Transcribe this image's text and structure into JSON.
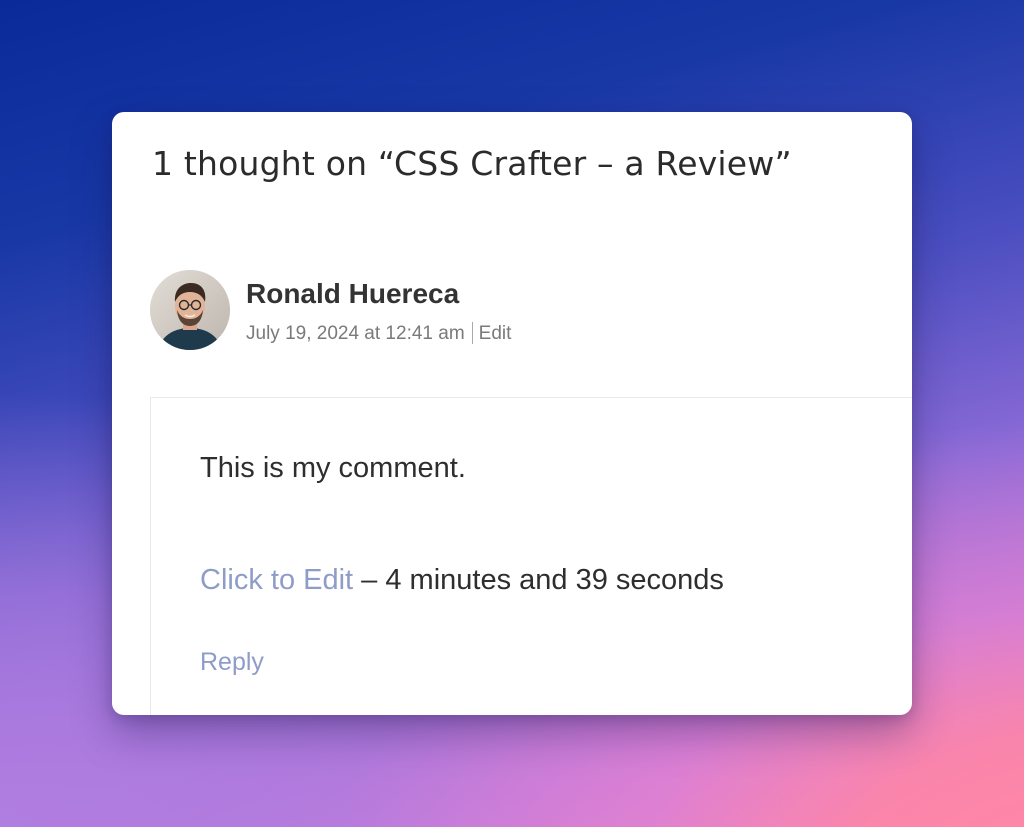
{
  "comments": {
    "title": "1 thought on “CSS Crafter – a Review”"
  },
  "comment": {
    "author": "Ronald Huereca",
    "avatar_icon": "user-avatar-photo",
    "date": "July 19, 2024 at 12:41 am",
    "edit_label": "Edit",
    "text": "This is my comment.",
    "click_to_edit_label": "Click to Edit",
    "edit_timer_text": " – 4 minutes and 39 seconds",
    "reply_label": "Reply"
  },
  "colors": {
    "link": "#8f9cc9",
    "text": "#2e2e2e",
    "meta": "#7a7a7a",
    "card": "#ffffff"
  }
}
